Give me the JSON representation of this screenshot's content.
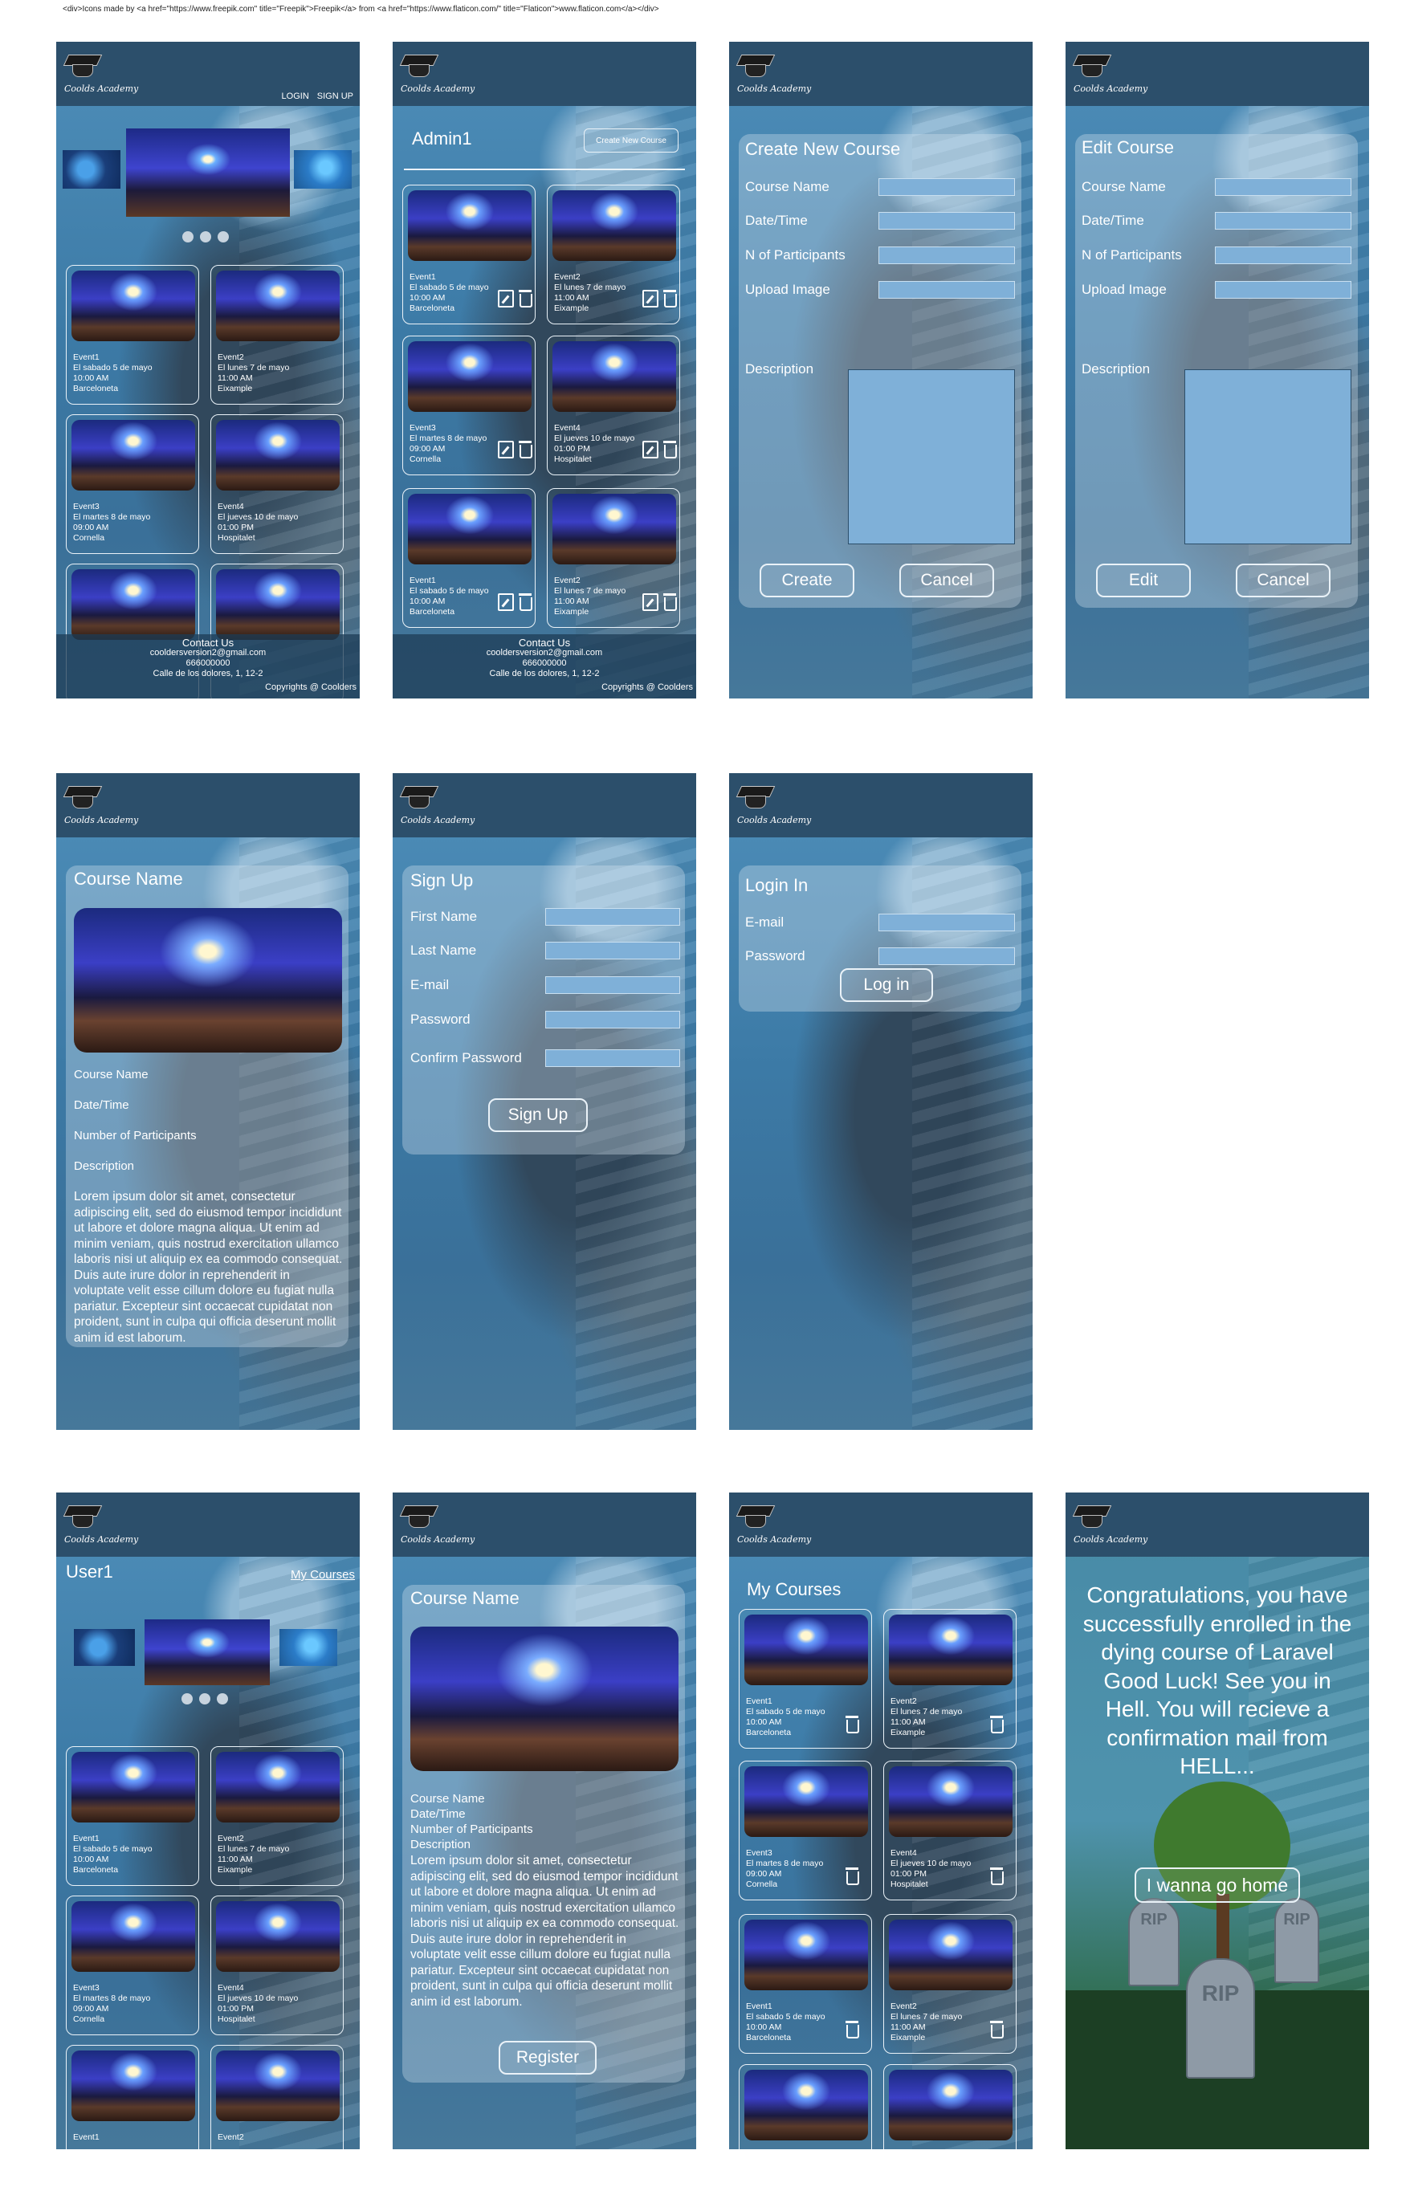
{
  "credit": "<div>Icons made by <a href=\"https://www.freepik.com\" title=\"Freepik\">Freepik</a> from <a href=\"https://www.flaticon.com/\" title=\"Flaticon\">www.flaticon.com</a></div>",
  "brand": "Coolds Academy",
  "home": {
    "login": "LOGIN",
    "signup": "SIGN UP"
  },
  "events": [
    {
      "name": "Event1",
      "date": "El sabado 5 de mayo",
      "time": "10:00 AM",
      "place": "Barceloneta"
    },
    {
      "name": "Event2",
      "date": "El lunes 7 de mayo",
      "time": "11:00 AM",
      "place": "Eixample"
    },
    {
      "name": "Event3",
      "date": "El martes 8 de mayo",
      "time": "09:00 AM",
      "place": "Cornella"
    },
    {
      "name": "Event4",
      "date": "El jueves 10 de mayo",
      "time": "01:00 PM",
      "place": "Hospitalet"
    }
  ],
  "footer": {
    "contact": "Contact Us",
    "email": "cooldersversion2@gmail.com",
    "phone": "666000000",
    "address": "Calle de los dolores, 1, 12-2",
    "copyright": "Copyrights @ Coolders"
  },
  "admin": {
    "user": "Admin1",
    "create_button": "Create New Course"
  },
  "create": {
    "title": "Create New Course",
    "course_name": "Course Name",
    "datetime": "Date/Time",
    "participants": "N of Participants",
    "upload": "Upload Image",
    "description": "Description",
    "create": "Create",
    "cancel": "Cancel"
  },
  "edit": {
    "title": "Edit Course",
    "course_name": "Course Name",
    "datetime": "Date/Time",
    "participants": "N of Participants",
    "upload": "Upload Image",
    "description": "Description",
    "edit": "Edit",
    "cancel": "Cancel"
  },
  "detail": {
    "title": "Course Name",
    "course_name": "Course Name",
    "datetime": "Date/Time",
    "participants": "Number of Participants",
    "description": "Description",
    "lorem": "Lorem ipsum dolor sit amet, consectetur adipiscing elit, sed do eiusmod tempor incididunt ut labore et dolore magna aliqua. Ut enim ad minim veniam, quis nostrud exercitation ullamco laboris nisi ut aliquip ex ea commodo consequat. Duis aute irure dolor in reprehenderit in voluptate velit esse cillum dolore eu fugiat nulla pariatur. Excepteur sint occaecat cupidatat non proident, sunt in culpa qui officia deserunt mollit anim id est laborum."
  },
  "signup": {
    "title": "Sign Up",
    "first": "First Name",
    "last": "Last Name",
    "email": "E-mail",
    "password": "Password",
    "confirm": "Confirm Password",
    "button": "Sign Up"
  },
  "login": {
    "title": "Login In",
    "email": "E-mail",
    "password": "Password",
    "button": "Log in"
  },
  "user": {
    "name": "User1",
    "my_courses": "My Courses"
  },
  "register": {
    "title": "Course Name",
    "course_name": "Course Name",
    "datetime": "Date/Time",
    "participants": "Number of Participants",
    "description": "Description",
    "button": "Register"
  },
  "mycourses": {
    "title": "My Courses"
  },
  "congrats": {
    "message": "Congratulations, you have successfully enrolled in the dying course of Laravel Good Luck! See you in Hell. You will recieve a confirmation mail from HELL...",
    "button": "I wanna go home",
    "rip": "RIP"
  }
}
